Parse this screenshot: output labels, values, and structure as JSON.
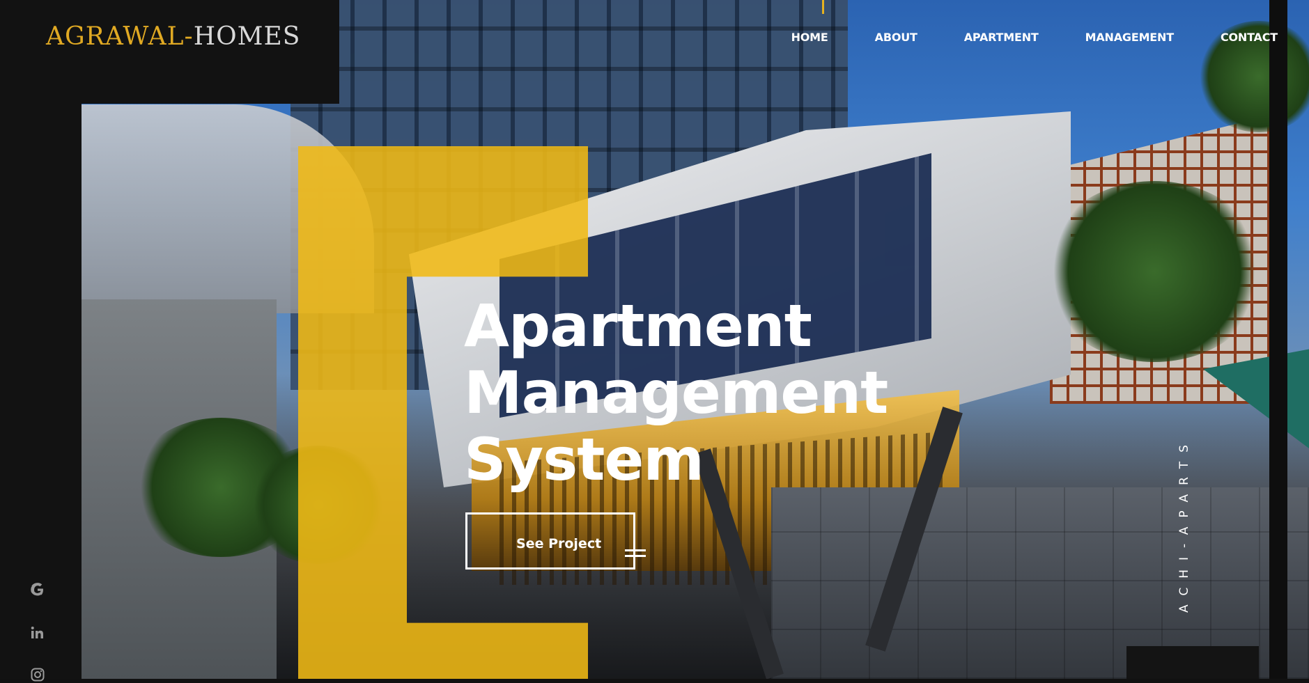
{
  "brand": {
    "logo_part1": "AGRAWAL-",
    "logo_part2": "HOMES"
  },
  "nav": {
    "items": [
      "HOME",
      "ABOUT",
      "APARTMENT",
      "MANAGEMENT",
      "CONTACT"
    ]
  },
  "hero": {
    "title_lines": [
      "Apartment",
      "Management",
      "System"
    ],
    "cta_label": "See Project",
    "vertical_text": "ACHI-APARTS"
  },
  "social": {
    "icons": [
      "google-icon",
      "linkedin-icon",
      "instagram-icon"
    ]
  },
  "colors": {
    "accent": "#f0b914",
    "dark": "#121212",
    "text": "#ffffff"
  }
}
